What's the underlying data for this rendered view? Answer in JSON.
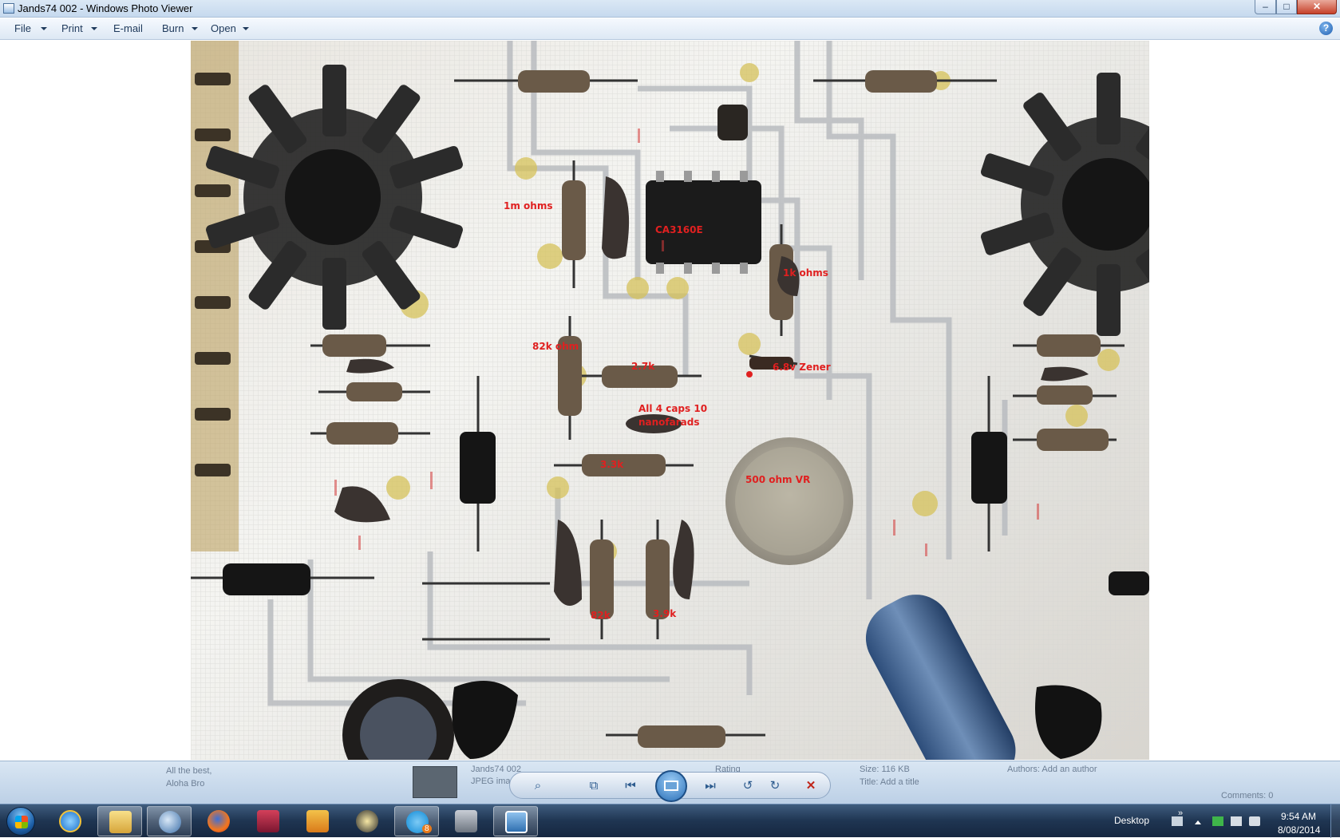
{
  "window": {
    "title": "Jands74 002 - Windows Photo Viewer",
    "minimize_glyph": "–",
    "maximize_glyph": "□",
    "close_glyph": "✕"
  },
  "menu": {
    "file": "File",
    "print": "Print",
    "email": "E-mail",
    "burn": "Burn",
    "open": "Open",
    "help_glyph": "?"
  },
  "photo_labels": {
    "label_1m": "1m ohms",
    "label_ca3160e": "CA3160E",
    "label_1k": "1k ohms",
    "label_82k_ohm": "82k ohm",
    "label_27k": "2.7k",
    "label_zener": "6.8v Zener",
    "label_caps_1": "All 4 caps 10",
    "label_caps_2": "nanofarads",
    "label_33k": "3.3k",
    "label_vr": "500 ohm VR",
    "label_82k": "82k",
    "label_39k": "3.9k"
  },
  "infobar": {
    "left_line1": "All the best,",
    "left_line2": "Aloha Bro",
    "file_line1": "Jands74 002",
    "file_line2": "JPEG image",
    "size_line1": "Size: 116 KB",
    "size_line2": "Title: Add a title",
    "authors": "Authors: Add an author",
    "comments": "Comments: 0",
    "rating": "Rating"
  },
  "controls": {
    "zoom_glyph": "⌕",
    "actual_size_glyph": "⧉",
    "prev_glyph": "⏮",
    "next_glyph": "⏭",
    "rotate_ccw_glyph": "↺",
    "rotate_cw_glyph": "↻",
    "delete_glyph": "✕"
  },
  "taskbar": {
    "desktop_label": "Desktop",
    "chevron": "»",
    "clock_time": "9:54 AM",
    "clock_date": "8/08/2014",
    "skype_badge": "8"
  },
  "colors": {
    "label_red": "#e02020",
    "heatsink": "#2a2a2a",
    "trace": "#b9bcc0"
  }
}
